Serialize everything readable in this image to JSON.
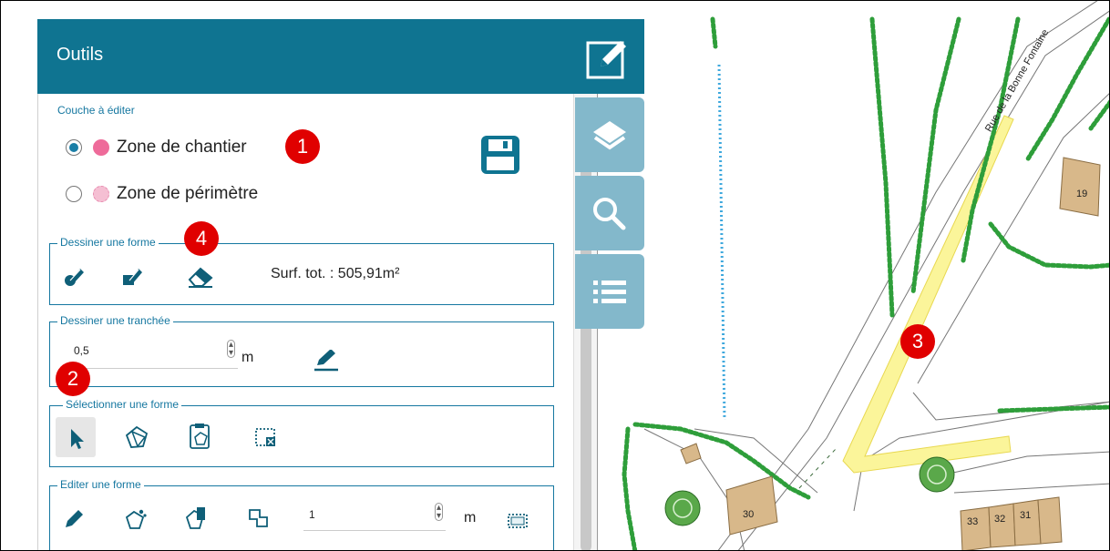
{
  "panel": {
    "title": "Outils",
    "layer_section_label": "Couche à éditer",
    "layers": [
      {
        "label": "Zone de chantier",
        "checked": true,
        "color": "#ee6b9a"
      },
      {
        "label": "Zone de périmètre",
        "checked": false,
        "color": "#f5bfd3"
      }
    ],
    "draw_shape": {
      "legend": "Dessiner une forme",
      "surface_text": "Surf. tot. : 505,91m²"
    },
    "trench": {
      "legend": "Dessiner une tranchée",
      "value": "0,5",
      "unit": "m"
    },
    "select_shape": {
      "legend": "Sélectionner une forme"
    },
    "edit_shape": {
      "legend": "Editer une forme",
      "value": "1",
      "unit": "m"
    }
  },
  "badges": [
    "1",
    "2",
    "3",
    "4"
  ],
  "map": {
    "street_name": "Rue de la Bonne Fontaine",
    "lot_labels": [
      "19",
      "30",
      "33",
      "32",
      "31"
    ],
    "highlight_color": "#fbf59a",
    "hedge_color": "#2e9e3a",
    "building_color": "#d8b88a"
  },
  "icons": [
    "edit-icon",
    "layers-icon",
    "search-icon",
    "list-icon",
    "save-icon",
    "draw-polygon-icon",
    "draw-freehand-icon",
    "eraser-icon",
    "pencil-icon",
    "pointer-icon",
    "select-polygon-icon",
    "clipboard-polygon-icon",
    "select-box-icon",
    "vertex-edit-icon",
    "scale-icon",
    "clone-icon",
    "buffer-icon",
    "bbox-icon"
  ]
}
